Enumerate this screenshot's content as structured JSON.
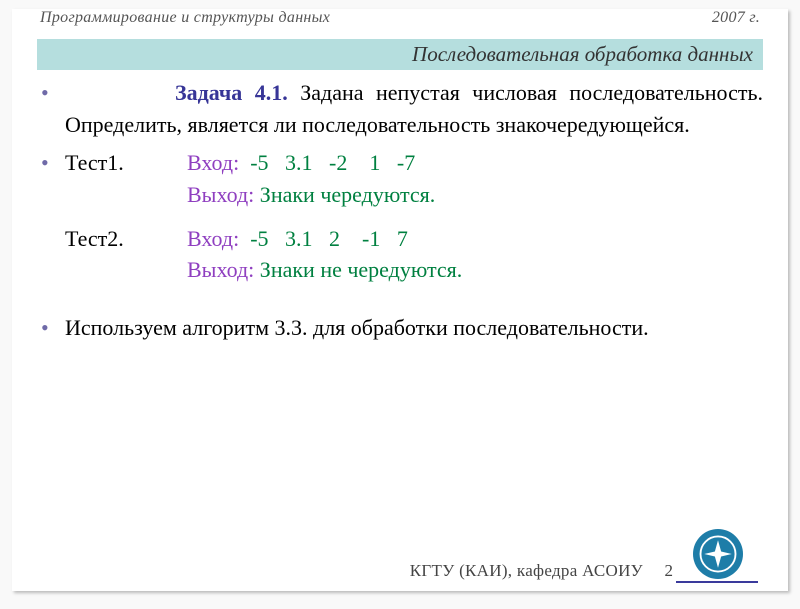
{
  "header": {
    "left": "Программирование  и структуры данных",
    "right": "2007 г."
  },
  "title_bar": "Последовательная обработка данных",
  "problem": {
    "heading": "Задача 4.1.",
    "text": "Задана непустая числовая последовательность. Определить, является ли последовательность знакочередующейся."
  },
  "tests": [
    {
      "label": "Тест1.",
      "in_lbl": "Вход:",
      "in_val": "  -5   3.1   -2    1   -7",
      "out_lbl": "Выход:",
      "out_val": " Знаки чередуются."
    },
    {
      "label": "Тест2.",
      "in_lbl": "Вход:",
      "in_val": "  -5   3.1   2    -1   7",
      "out_lbl": "Выход:",
      "out_val": " Знаки не чередуются."
    }
  ],
  "algo_note": "Используем алгоритм 3.3. для обработки последовательности.",
  "footer": {
    "org": "КГТУ  (КАИ),  кафедра АСОИУ",
    "page": "2"
  }
}
